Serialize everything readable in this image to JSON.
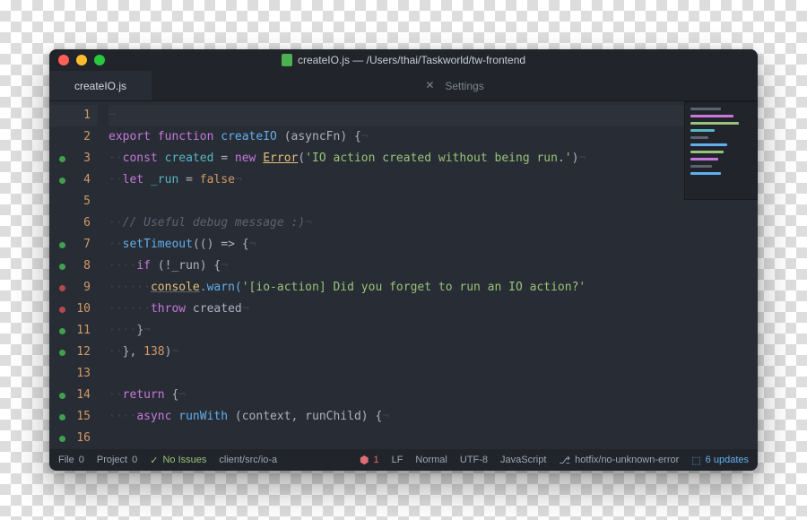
{
  "window": {
    "title": "createIO.js — /Users/thai/Taskworld/tw-frontend"
  },
  "tabs": [
    {
      "label": "createIO.js",
      "active": true
    },
    {
      "label": "Settings",
      "active": false,
      "icon": "wrench-icon"
    }
  ],
  "gutter": [
    {
      "n": "1",
      "mark": null,
      "current": true
    },
    {
      "n": "2",
      "mark": null
    },
    {
      "n": "3",
      "mark": "green"
    },
    {
      "n": "4",
      "mark": "green"
    },
    {
      "n": "5",
      "mark": null
    },
    {
      "n": "6",
      "mark": null
    },
    {
      "n": "7",
      "mark": "green"
    },
    {
      "n": "8",
      "mark": "green"
    },
    {
      "n": "9",
      "mark": "red"
    },
    {
      "n": "10",
      "mark": "red"
    },
    {
      "n": "11",
      "mark": "green"
    },
    {
      "n": "12",
      "mark": "green"
    },
    {
      "n": "13",
      "mark": null
    },
    {
      "n": "14",
      "mark": "green"
    },
    {
      "n": "15",
      "mark": "green"
    },
    {
      "n": "16",
      "mark": "green"
    }
  ],
  "code": {
    "l2_export": "export",
    "l2_function": "function",
    "l2_name": "createIO",
    "l2_args": "(asyncFn) {",
    "l3_const": "const",
    "l3_created": "created",
    "l3_eq": " = ",
    "l3_new": "new",
    "l3_error": "Error",
    "l3_str": "'IO action created without being run.'",
    "l4_let": "let",
    "l4_run": "_run",
    "l4_eq": " = ",
    "l4_false": "false",
    "l6_cm": "// Useful debug message :)",
    "l7_fn": "setTimeout",
    "l7_rest": "(() => {",
    "l8_if": "if",
    "l8_cond": " (!_run) {",
    "l9_console": "console",
    "l9_warn": ".warn(",
    "l9_str": "'[io-action] Did you forget to run an IO action?'",
    "l10_throw": "throw",
    "l10_created": " created",
    "l11_brace": "}",
    "l12_close": "}, ",
    "l12_num": "138",
    "l12_paren": ")",
    "l14_return": "return",
    "l14_brace": " {",
    "l15_async": "async",
    "l15_fn": "runWith",
    "l15_args": " (context, runChild) {"
  },
  "status": {
    "file": "File",
    "file_count": "0",
    "project": "Project",
    "project_count": "0",
    "issues": "No Issues",
    "path": "client/src/io-a",
    "errors": "1",
    "eol": "LF",
    "mode": "Normal",
    "encoding": "UTF-8",
    "lang": "JavaScript",
    "branch": "hotfix/no-unknown-error",
    "updates": "6 updates"
  }
}
